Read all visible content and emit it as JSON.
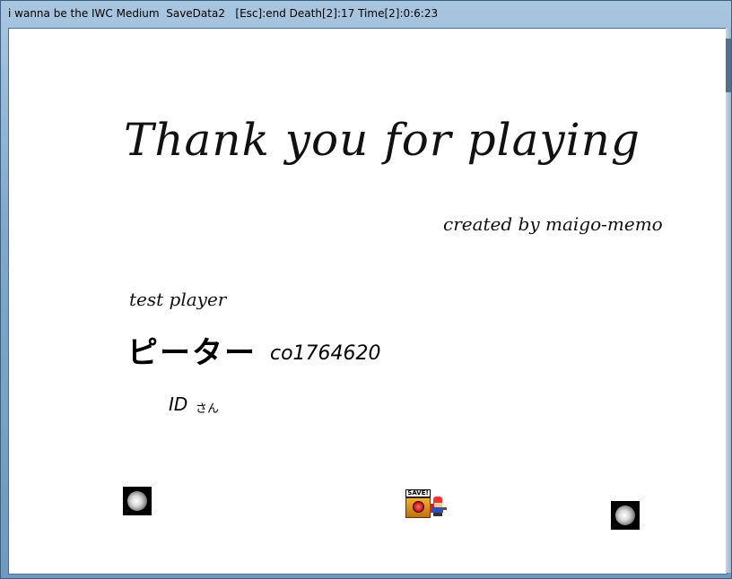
{
  "window": {
    "title": "i wanna be the IWC Medium  SaveData2   [Esc]:end Death[2]:17 Time[2]:0:6:23"
  },
  "game": {
    "thanks_text": "Thank you for playing",
    "credit_text": "created by maigo-memo",
    "tester_label": "test player",
    "player_name": "ピーター",
    "player_code": "co1764620",
    "id_label": "ID",
    "honorific": "さん",
    "save_label": "SAVE!"
  },
  "colors": {
    "background": "#ffffff",
    "text": "#111111",
    "title_bar": "#7fa8cc"
  },
  "icons": {
    "smoke_left": "smoke-cloud-icon",
    "smoke_right": "smoke-cloud-icon",
    "save_point": "save-point-icon",
    "player_character": "kid-character-icon"
  }
}
